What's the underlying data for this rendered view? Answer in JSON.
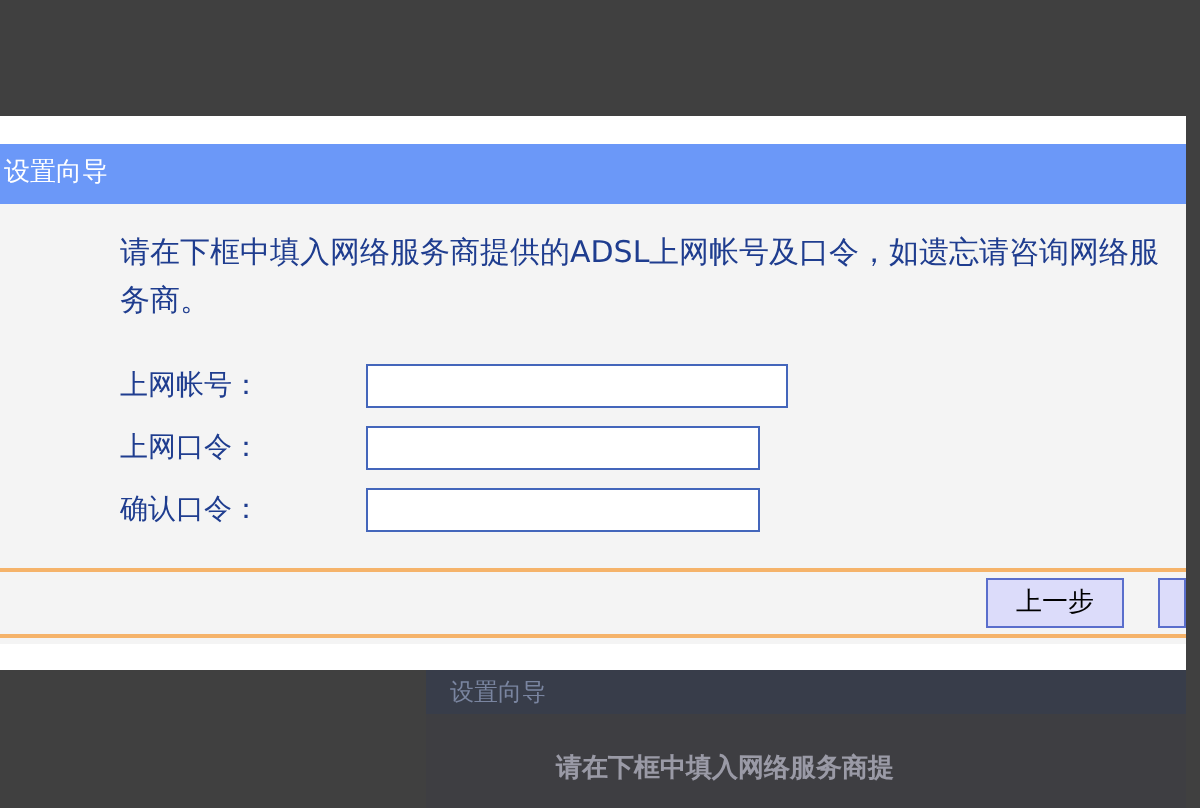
{
  "window": {
    "title": "设置向导"
  },
  "instruction": "请在下框中填入网络服务商提供的ADSL上网帐号及口令，如遗忘请咨询网络服务商。",
  "fields": [
    {
      "label": "上网帐号："
    },
    {
      "label": "上网口令："
    },
    {
      "label": "确认口令："
    }
  ],
  "buttons": [
    {
      "label": "上一步"
    }
  ],
  "background_window": {
    "title": "设置向导",
    "instruction": "请在下框中填入网络服务商提"
  }
}
